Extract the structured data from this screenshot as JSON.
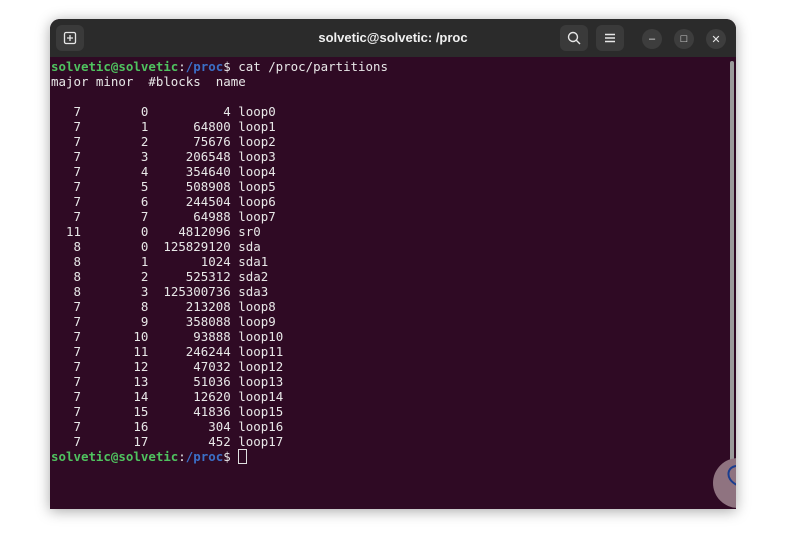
{
  "window": {
    "title": "solvetic@solvetic: /proc"
  },
  "titlebar": {
    "new_tab_icon": "new-tab-icon",
    "search_icon": "search-icon",
    "menu_icon": "hamburger-menu-icon",
    "minimize": "–",
    "maximize": "□",
    "close": "✕"
  },
  "prompt": {
    "user_host": "solvetic@solvetic",
    "sep": ":",
    "path": "/proc",
    "dollar": "$"
  },
  "command": " cat /proc/partitions",
  "header": "major minor  #blocks  name",
  "rows": [
    {
      "major": "7",
      "minor": "0",
      "blocks": "4",
      "name": "loop0"
    },
    {
      "major": "7",
      "minor": "1",
      "blocks": "64800",
      "name": "loop1"
    },
    {
      "major": "7",
      "minor": "2",
      "blocks": "75676",
      "name": "loop2"
    },
    {
      "major": "7",
      "minor": "3",
      "blocks": "206548",
      "name": "loop3"
    },
    {
      "major": "7",
      "minor": "4",
      "blocks": "354640",
      "name": "loop4"
    },
    {
      "major": "7",
      "minor": "5",
      "blocks": "508908",
      "name": "loop5"
    },
    {
      "major": "7",
      "minor": "6",
      "blocks": "244504",
      "name": "loop6"
    },
    {
      "major": "7",
      "minor": "7",
      "blocks": "64988",
      "name": "loop7"
    },
    {
      "major": "11",
      "minor": "0",
      "blocks": "4812096",
      "name": "sr0"
    },
    {
      "major": "8",
      "minor": "0",
      "blocks": "125829120",
      "name": "sda"
    },
    {
      "major": "8",
      "minor": "1",
      "blocks": "1024",
      "name": "sda1"
    },
    {
      "major": "8",
      "minor": "2",
      "blocks": "525312",
      "name": "sda2"
    },
    {
      "major": "8",
      "minor": "3",
      "blocks": "125300736",
      "name": "sda3"
    },
    {
      "major": "7",
      "minor": "8",
      "blocks": "213208",
      "name": "loop8"
    },
    {
      "major": "7",
      "minor": "9",
      "blocks": "358088",
      "name": "loop9"
    },
    {
      "major": "7",
      "minor": "10",
      "blocks": "93888",
      "name": "loop10"
    },
    {
      "major": "7",
      "minor": "11",
      "blocks": "246244",
      "name": "loop11"
    },
    {
      "major": "7",
      "minor": "12",
      "blocks": "47032",
      "name": "loop12"
    },
    {
      "major": "7",
      "minor": "13",
      "blocks": "51036",
      "name": "loop13"
    },
    {
      "major": "7",
      "minor": "14",
      "blocks": "12620",
      "name": "loop14"
    },
    {
      "major": "7",
      "minor": "15",
      "blocks": "41836",
      "name": "loop15"
    },
    {
      "major": "7",
      "minor": "16",
      "blocks": "304",
      "name": "loop16"
    },
    {
      "major": "7",
      "minor": "17",
      "blocks": "452",
      "name": "loop17"
    }
  ],
  "colors": {
    "terminal_bg": "#2f0a24",
    "user_host": "#4fc25f",
    "path": "#3b6fc7"
  }
}
